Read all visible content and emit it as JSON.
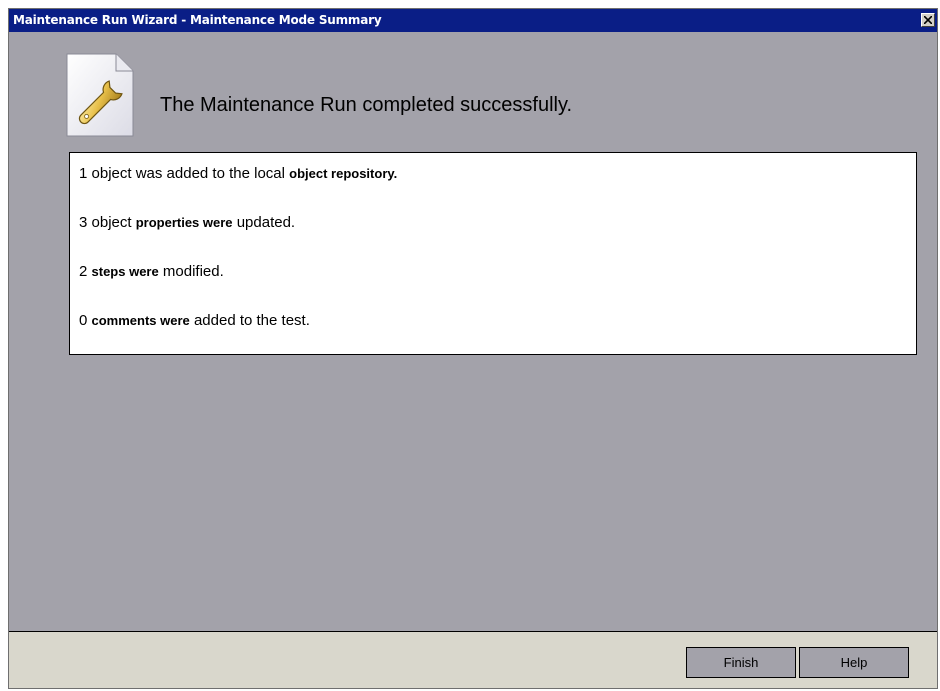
{
  "window": {
    "title": "Maintenance Run Wizard - Maintenance Mode Summary"
  },
  "header": {
    "icon": "wrench-document-icon",
    "message": "The Maintenance Run completed successfully."
  },
  "summary": {
    "lines": [
      {
        "prefix": "1 object was added to the local ",
        "bold": "object repository.",
        "suffix": ""
      },
      {
        "prefix": "3 object ",
        "bold": "properties were",
        "suffix": " updated."
      },
      {
        "prefix": "2 ",
        "bold": "steps were",
        "suffix": " modified."
      },
      {
        "prefix": "0 ",
        "bold": "comments were",
        "suffix": " added to the test."
      }
    ]
  },
  "buttons": {
    "finish_label": "Finish",
    "help_label": "Help"
  },
  "colors": {
    "title_bar": "#0a1e86",
    "body_background": "#a3a2aa",
    "footer_background": "#d9d7cc"
  }
}
